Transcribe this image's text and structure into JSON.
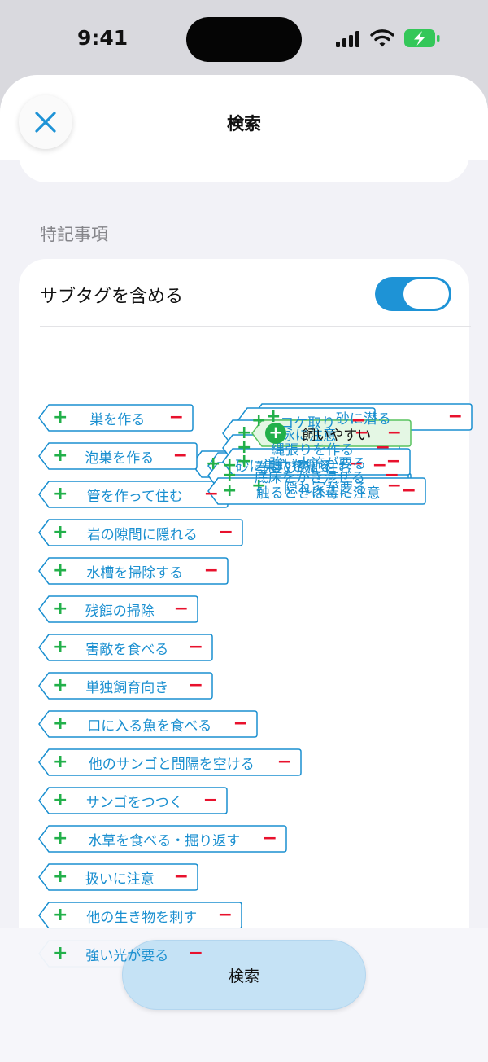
{
  "status": {
    "time": "9:41",
    "battery_color": "#34c759"
  },
  "header": {
    "title": "検索",
    "close_icon": "close-icon"
  },
  "section": {
    "title": "特記事項"
  },
  "subtag": {
    "label": "サブタグを含める",
    "enabled": true
  },
  "tags": [
    {
      "label": "巣を作る"
    },
    {
      "label": "砂に巣穴を掘る"
    },
    {
      "label": "泡巣を作る"
    },
    {
      "label": "巻貝の殻に住む"
    },
    {
      "label": "管を作って住む"
    },
    {
      "label": "隠れ家が要る"
    },
    {
      "label": "岩の隙間に隠れる"
    },
    {
      "label": "砂に潜る"
    },
    {
      "label": "水槽を掃除する"
    },
    {
      "label": "コケ取り"
    },
    {
      "label": "残餌の掃除"
    },
    {
      "label": "底床をかき混ぜる"
    },
    {
      "label": "害敵を食べる"
    },
    {
      "label": "混泳に注意"
    },
    {
      "label": "単独飼育向き"
    },
    {
      "label": "縄張りを作る"
    },
    {
      "label": "口に入る魚を食べる"
    },
    {
      "label": "他のサンゴと間隔を空ける"
    },
    {
      "label": "サンゴをつつく"
    },
    {
      "label": "水草を食べる・掘り返す"
    },
    {
      "label": "扱いに注意"
    },
    {
      "label": "触るときは毒に注意"
    },
    {
      "label": "他の生き物を刺す"
    },
    {
      "label": "飼いやすい",
      "selected": true
    },
    {
      "label": "強い光が要る"
    },
    {
      "label": "強い水流が要る"
    }
  ],
  "tag_symbols": {
    "include": "+",
    "exclude": "−"
  },
  "colors": {
    "accent": "#1e93d6",
    "tag_text": "#1a8fd0",
    "plus": "#22b04a",
    "minus": "#e8112d",
    "selected_fill": "#e4f7e4",
    "selected_border": "#58c35f"
  },
  "bottom": {
    "search_label": "検索"
  }
}
